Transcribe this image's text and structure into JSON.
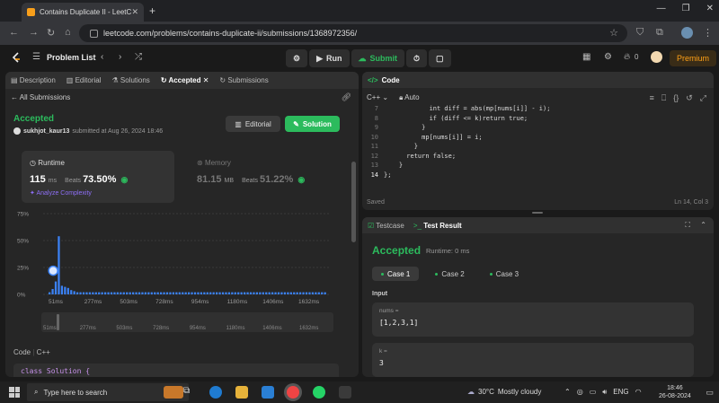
{
  "browser": {
    "tab_title": "Contains Duplicate II - LeetCode",
    "url": "leetcode.com/problems/contains-duplicate-ii/submissions/1368972356/"
  },
  "topbar": {
    "problem_list": "Problem List",
    "run": "Run",
    "submit": "Submit",
    "notif_count": "0",
    "premium": "Premium"
  },
  "left_tabs": [
    {
      "label": "Description"
    },
    {
      "label": "Editorial"
    },
    {
      "label": "Solutions"
    },
    {
      "label": "Accepted"
    },
    {
      "label": "Submissions"
    }
  ],
  "submission": {
    "all_submissions": "All Submissions",
    "status": "Accepted",
    "user": "sukhjot_kaur13",
    "submitted_text": "submitted at Aug 26, 2024 18:46",
    "editorial_btn": "Editorial",
    "solution_btn": "Solution",
    "runtime_label": "Runtime",
    "runtime_value": "115",
    "runtime_unit": "ms",
    "beats_label": "Beats",
    "runtime_beats": "73.50%",
    "analyze": "Analyze Complexity",
    "memory_label": "Memory",
    "memory_value": "81.15",
    "memory_unit": "MB",
    "memory_beats": "51.22%",
    "code_section": "Code",
    "code_lang": "C++",
    "code_snippet": "class Solution {"
  },
  "chart_data": {
    "type": "bar",
    "y_ticks": [
      "75%",
      "50%",
      "25%",
      "0%"
    ],
    "ylim": [
      0,
      75
    ],
    "x_tick_labels": [
      "51ms",
      "277ms",
      "503ms",
      "728ms",
      "954ms",
      "1180ms",
      "1406ms",
      "1632ms"
    ],
    "values": [
      2,
      5,
      12,
      54,
      8,
      7,
      6,
      4,
      3,
      2,
      2,
      2,
      2,
      2,
      2,
      2,
      2,
      2,
      2,
      2,
      2,
      2,
      2,
      2,
      2,
      2,
      2,
      2,
      2,
      2,
      2,
      2,
      2,
      2,
      2,
      2,
      2,
      2,
      2,
      2,
      2,
      2,
      2,
      2,
      2,
      2,
      2,
      2,
      2,
      2,
      2,
      2,
      2,
      2,
      2,
      2,
      2,
      2,
      2,
      2,
      2,
      2,
      2,
      2,
      2,
      2,
      2,
      2,
      2,
      2,
      2,
      2,
      2,
      2,
      2,
      2,
      2,
      2,
      2,
      2,
      2,
      2,
      2,
      2,
      2,
      2,
      2,
      2,
      2,
      2
    ],
    "marker_value": 22,
    "accent": "#3b82f6"
  },
  "code_panel": {
    "title": "Code",
    "lang": "C++",
    "mode": "Auto",
    "lines": [
      {
        "n": "7",
        "t": "            int diff = abs(mp[nums[i]] - i);"
      },
      {
        "n": "8",
        "t": "            if (diff <= k)return true;"
      },
      {
        "n": "9",
        "t": "          }"
      },
      {
        "n": "10",
        "t": "          mp[nums[i]] = i;"
      },
      {
        "n": "11",
        "t": "        }"
      },
      {
        "n": "12",
        "t": "      return false;"
      },
      {
        "n": "13",
        "t": "    }"
      },
      {
        "n": "14",
        "t": "};"
      }
    ],
    "saved": "Saved",
    "position": "Ln 14, Col 3"
  },
  "test_panel": {
    "testcase_tab": "Testcase",
    "result_tab": "Test Result",
    "status": "Accepted",
    "runtime": "Runtime: 0 ms",
    "cases": [
      "Case 1",
      "Case 2",
      "Case 3"
    ],
    "input_label": "Input",
    "inputs": [
      {
        "name": "nums =",
        "value": "[1,2,3,1]"
      },
      {
        "name": "k =",
        "value": "3"
      }
    ]
  },
  "taskbar": {
    "search": "Type here to search",
    "temp": "30°C",
    "weather": "Mostly cloudy",
    "lang": "ENG",
    "time": "18:46",
    "date": "26-08-2024"
  }
}
